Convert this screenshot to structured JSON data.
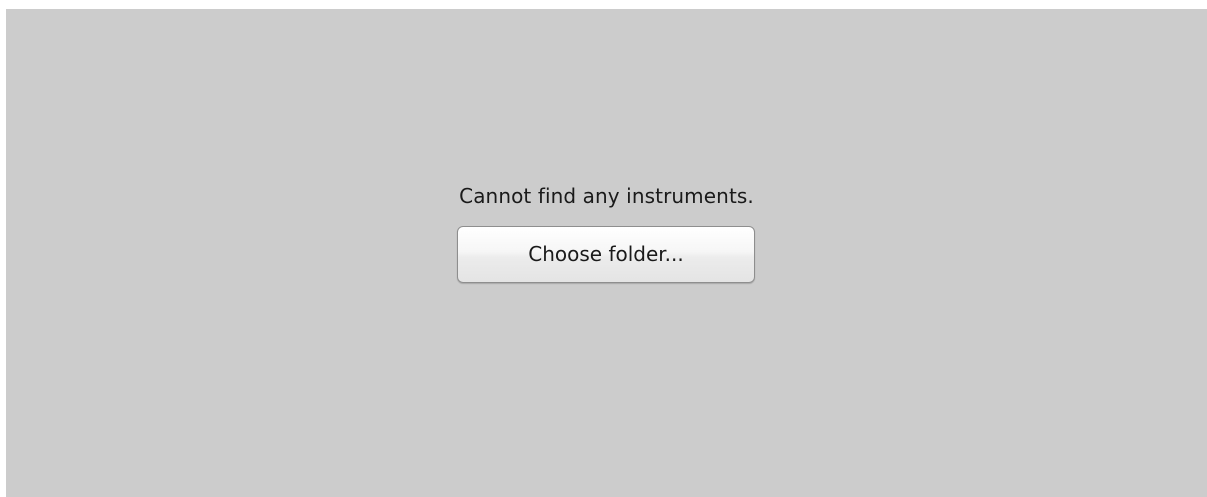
{
  "empty_state": {
    "message": "Cannot find any instruments.",
    "choose_folder_label": "Choose folder..."
  },
  "colors": {
    "panel_background": "#cccccc",
    "text": "#1a1a1a",
    "button_border": "#8e8e8e"
  }
}
